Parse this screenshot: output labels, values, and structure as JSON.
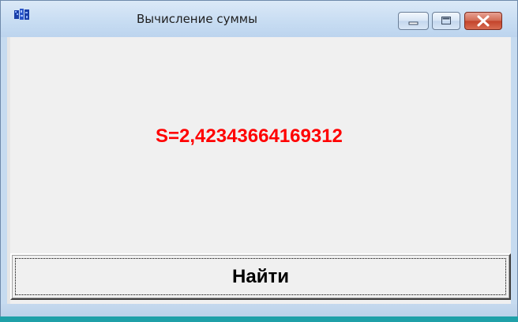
{
  "window": {
    "title": "Вычисление суммы",
    "app_icon": "app-icon",
    "controls": {
      "minimize_icon": "minimize-icon",
      "maximize_icon": "maximize-icon",
      "close_icon": "close-icon"
    }
  },
  "main": {
    "result_text": "S=2,42343664169312",
    "result_color": "#ff0000",
    "find_button_label": "Найти"
  }
}
